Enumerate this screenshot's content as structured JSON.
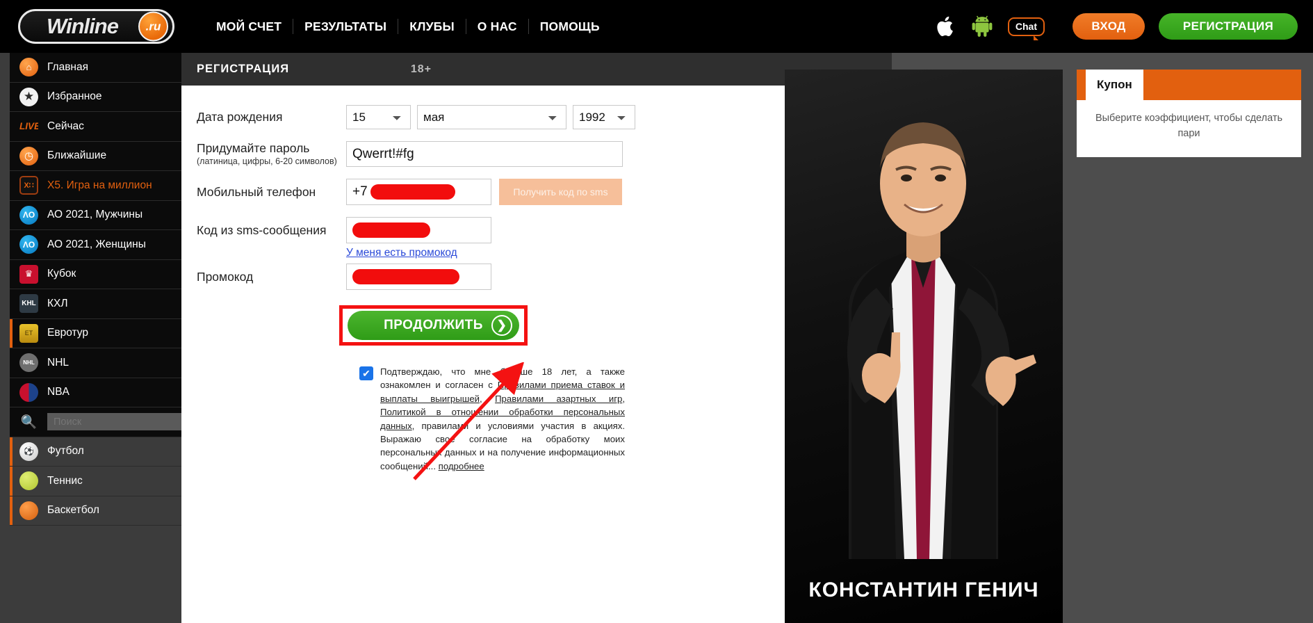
{
  "header": {
    "logo": {
      "word": "Winline",
      "tld": ".ru"
    },
    "nav": [
      {
        "label": "МОЙ СЧЕТ"
      },
      {
        "label": "РЕЗУЛЬТАТЫ"
      },
      {
        "label": "КЛУБЫ"
      },
      {
        "label": "О НАС"
      },
      {
        "label": "ПОМОЩЬ"
      }
    ],
    "icons": {
      "apple": "apple-icon",
      "android": "android-icon",
      "chat": "Chat"
    },
    "login_label": "ВХОД",
    "register_label": "РЕГИСТРАЦИЯ",
    "colors": {
      "orange": "#e2600f",
      "green": "#2f9c17"
    }
  },
  "sidebar": {
    "search_placeholder": "Поиск",
    "items": [
      {
        "label": "Главная",
        "icon": "home-icon",
        "glyph": "⌂"
      },
      {
        "label": "Избранное",
        "icon": "star-icon",
        "glyph": "★"
      },
      {
        "label": "Сейчас",
        "icon": "live-icon",
        "glyph": "LIVE"
      },
      {
        "label": "Ближайшие",
        "icon": "clock-icon",
        "glyph": "◴"
      },
      {
        "label": "X5. Игра на миллион",
        "icon": "dice-icon",
        "glyph": "X∷"
      },
      {
        "label": "АО 2021, Мужчины",
        "icon": "ao-logo-icon",
        "glyph": "ΛO"
      },
      {
        "label": "АО 2021, Женщины",
        "icon": "ao-logo-icon",
        "glyph": "ΛO"
      },
      {
        "label": "Кубок",
        "icon": "cup-icon",
        "glyph": "♛"
      },
      {
        "label": "КХЛ",
        "icon": "khl-logo-icon",
        "glyph": "KHL"
      },
      {
        "label": "Евротур",
        "icon": "eurotour-icon",
        "glyph": "ET"
      },
      {
        "label": "NHL",
        "icon": "nhl-logo-icon",
        "glyph": "NHL"
      },
      {
        "label": "NBA",
        "icon": "nba-logo-icon",
        "glyph": "NBA"
      },
      {
        "label": "Футбол",
        "icon": "football-icon",
        "glyph": "⚽"
      },
      {
        "label": "Теннис",
        "icon": "tennis-icon",
        "glyph": ""
      },
      {
        "label": "Баскетбол",
        "icon": "basketball-icon",
        "glyph": ""
      }
    ]
  },
  "main": {
    "section_title": "РЕГИСТРАЦИЯ",
    "age_badge": "18+",
    "form": {
      "birth_label": "Дата рождения",
      "birth_day": "15",
      "birth_month": "мая",
      "birth_year": "1992",
      "password_label": "Придумайте пароль",
      "password_hint": "(латиница, цифры, 6-20 символов)",
      "password_value": "Qwerrt!#fg",
      "phone_label": "Мобильный телефон",
      "phone_prefix": "+7",
      "sms_button_label": "Получить код по sms",
      "sms_code_label": "Код из sms-сообщения",
      "promo_link": "У меня есть промокод",
      "promo_label": "Промокод",
      "continue_label": "ПРОДОЛЖИТЬ",
      "continue_arrow": "❯"
    },
    "terms": {
      "checkbox_checked": "✔",
      "part1": "Подтверждаю, что мне больше 18 лет, а также ознакомлен и согласен с ",
      "link1": "Правилами приема ставок и выплаты выигрышей",
      "sep1": ", ",
      "link2": "Правилами азартных игр",
      "sep2": ", ",
      "link3": "Политикой в отношении обработки персональных данных",
      "part2": ", правилами и условиями участия в акциях. Выражаю свое согласие на обработку моих персональных данных и на получение информационных сообщений... ",
      "more_link": "подробнее"
    }
  },
  "banner": {
    "person_name": "КОНСТАНТИН ГЕНИЧ"
  },
  "coupon": {
    "tab_label": "Купон",
    "empty_text": "Выберите коэффициент, чтобы сделать пари"
  }
}
